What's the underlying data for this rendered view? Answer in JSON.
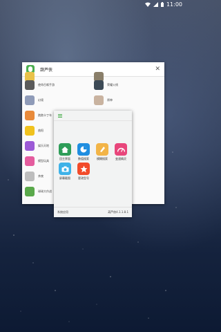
{
  "status_bar": {
    "time": "11:00"
  },
  "window": {
    "title": "葫芦侠",
    "apps": [
      {
        "label": "",
        "color": "#e9c24a",
        "col": 0
      },
      {
        "label": "",
        "color": "#8a7f6a",
        "col": 1
      },
      {
        "label": "使命召唤手游",
        "color": "#5b5b5b",
        "col": 0
      },
      {
        "label": "荣耀火线",
        "color": "#3c4a56",
        "col": 1
      },
      {
        "label": "幻境",
        "color": "#8f9bb8",
        "col": 0
      },
      {
        "label": "原神",
        "color": "#c9b3a0",
        "col": 1
      },
      {
        "label": "跑跑卡丁车",
        "color": "#e88a3a",
        "col": 0
      },
      {
        "label": "派派一夏",
        "color": "#e9a1b5",
        "col": 1
      },
      {
        "label": "曲阳",
        "color": "#f0c21e",
        "col": 0
      },
      {
        "label": "娱乐天地",
        "color": "#9c5ad6",
        "col": 0
      },
      {
        "label": "模型玩具",
        "color": "#e45c9e",
        "col": 0
      },
      {
        "label": "茶夜",
        "color": "#bdbdbd",
        "col": 0
      },
      {
        "label": "球球大作战",
        "color": "#5aa94b",
        "col": 0
      }
    ]
  },
  "popup": {
    "tools": [
      {
        "label": "回主界面",
        "color": "#2e9d58",
        "icon": "home-icon"
      },
      {
        "label": "数值搜索",
        "color": "#1f8ee0",
        "icon": "pie-chart-icon"
      },
      {
        "label": "模糊搜索",
        "color": "#f2b447",
        "icon": "pen-icon"
      },
      {
        "label": "变速精灵",
        "color": "#e8467b",
        "icon": "speedometer-icon"
      },
      {
        "label": "屏幕截图",
        "color": "#3eb2e8",
        "icon": "camera-icon"
      },
      {
        "label": "更改型号",
        "color": "#f24b2a",
        "icon": "star-icon"
      }
    ],
    "footer_left": "系统应用",
    "footer_right": "葫芦侠4.1.1.8.1"
  },
  "colors": {
    "accent": "#4caf50"
  }
}
